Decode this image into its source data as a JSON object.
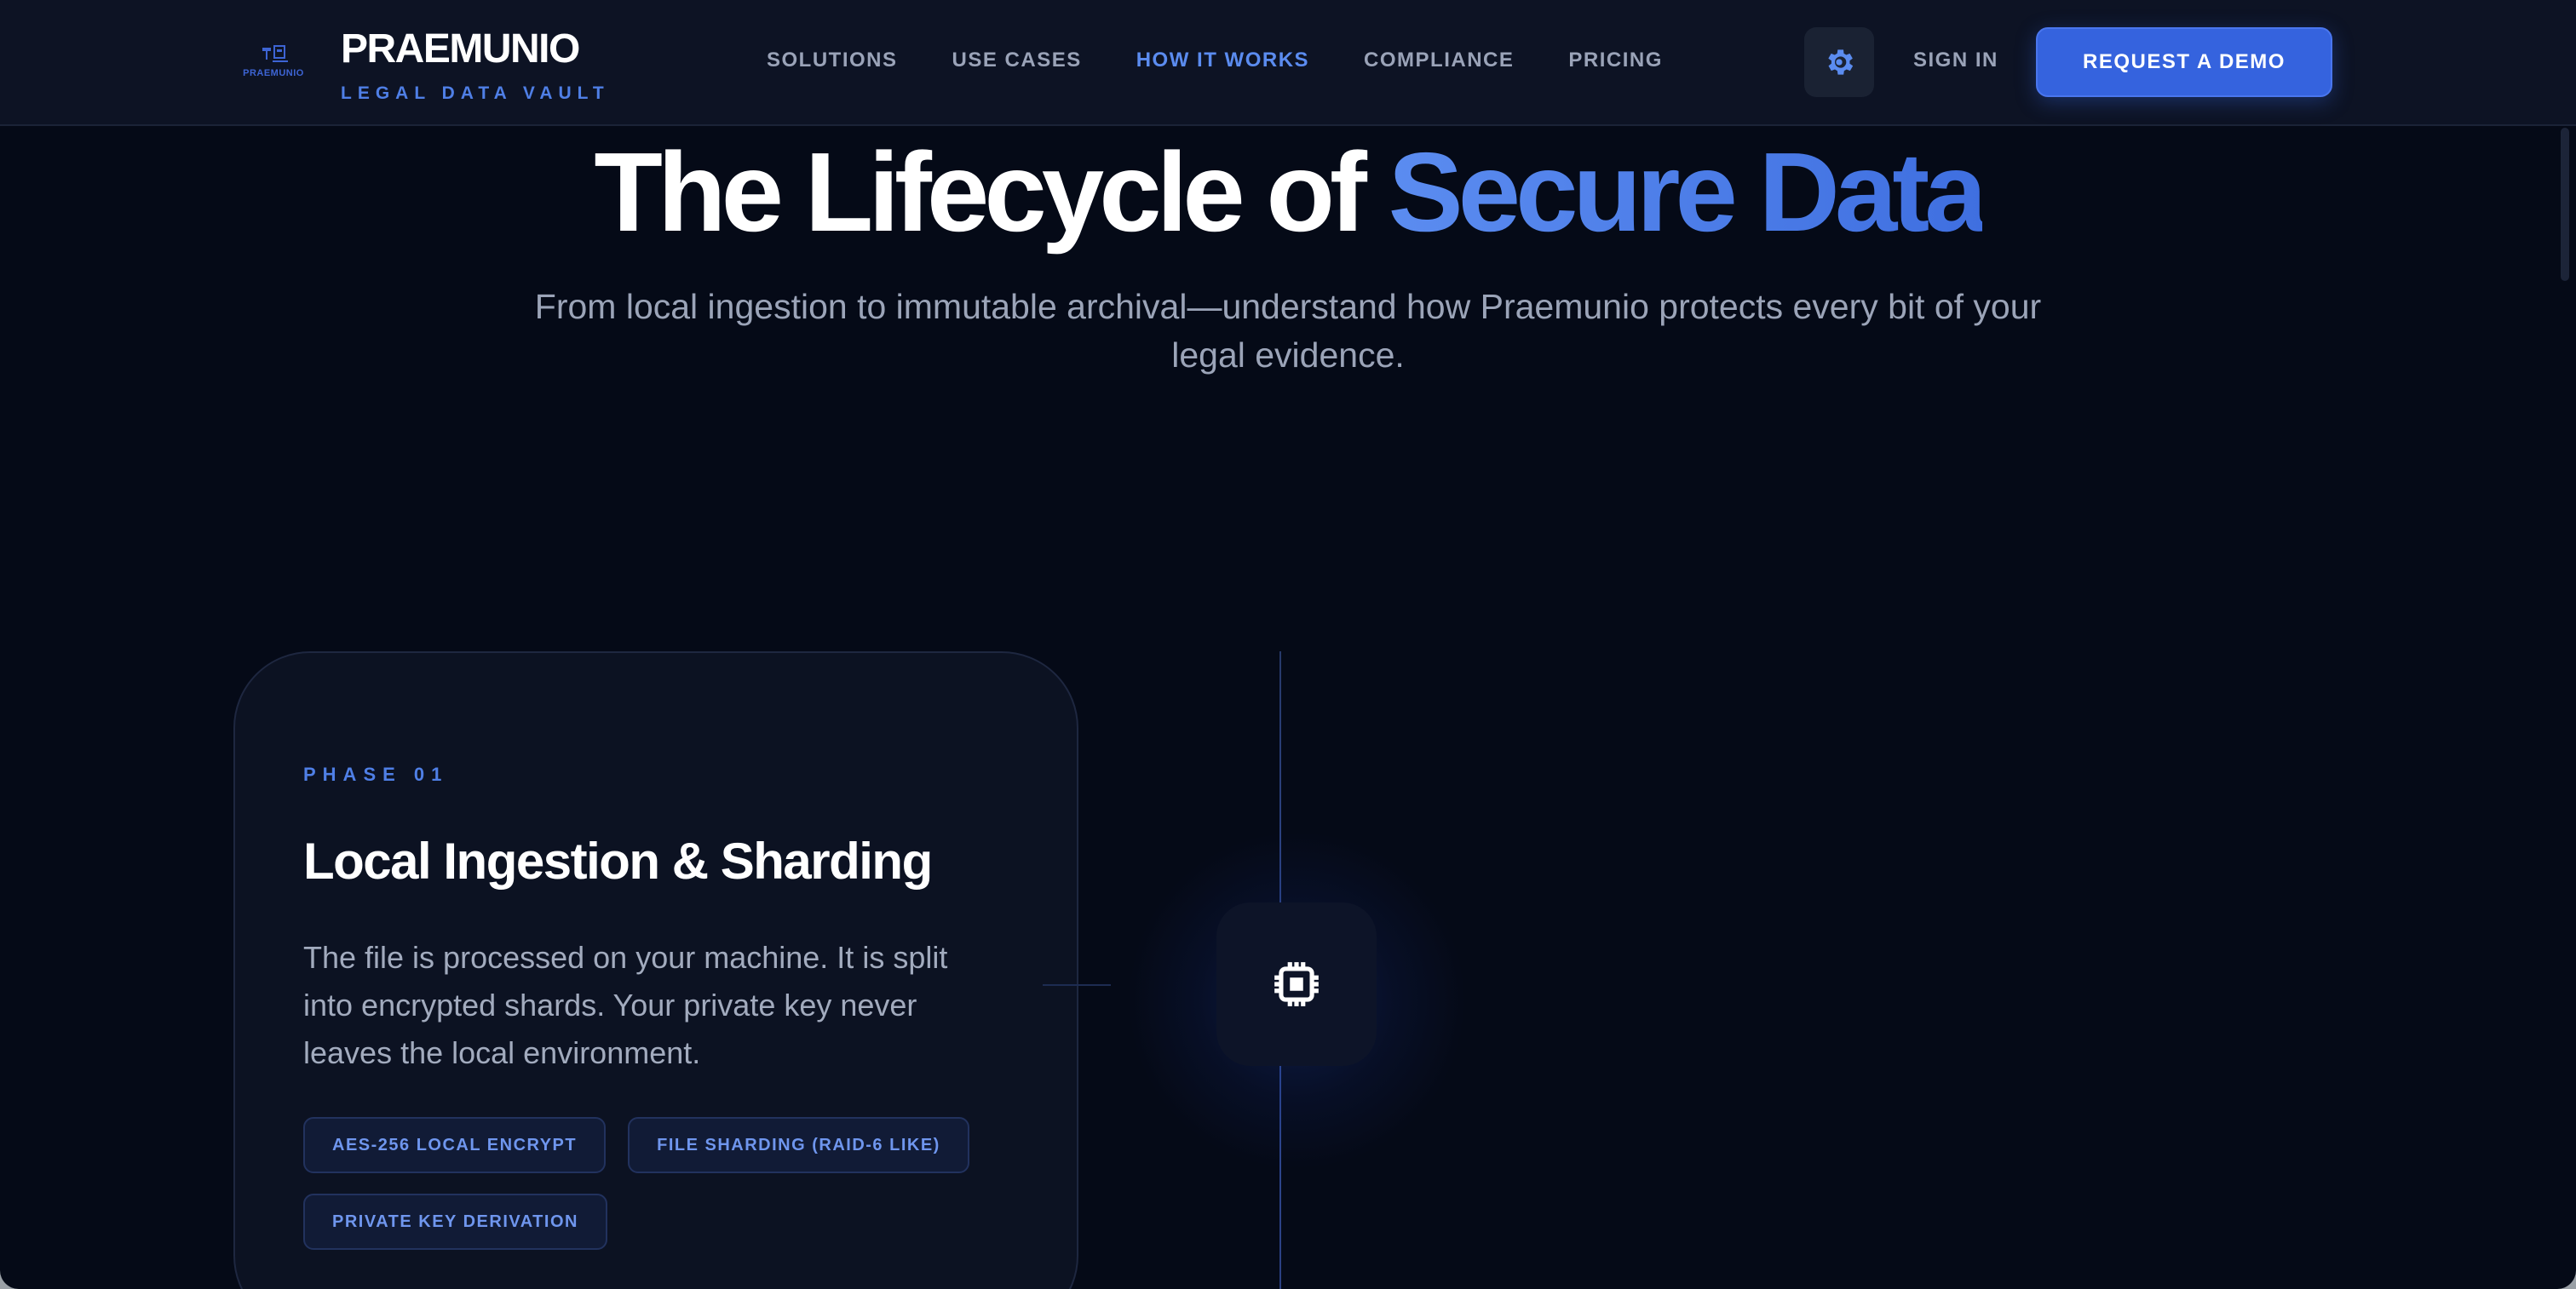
{
  "brand": {
    "mark_text": "PRAEMUNIO",
    "name": "PRAEMUNIO",
    "tagline": "LEGAL DATA VAULT"
  },
  "nav": {
    "links": [
      {
        "label": "SOLUTIONS",
        "active": false
      },
      {
        "label": "USE CASES",
        "active": false
      },
      {
        "label": "HOW IT WORKS",
        "active": true
      },
      {
        "label": "COMPLIANCE",
        "active": false
      },
      {
        "label": "PRICING",
        "active": false
      }
    ],
    "settings_icon": "gear-icon",
    "sign_in": "SIGN IN",
    "cta": "REQUEST A DEMO"
  },
  "hero": {
    "title_plain": "The Lifecycle of ",
    "title_accent": "Secure Data",
    "subtitle": "From local ingestion to immutable archival—understand how Praemunio protects every bit of your legal evidence."
  },
  "phase": {
    "label": "PHASE 01",
    "title": "Local Ingestion & Sharding",
    "description": "The file is processed on your machine. It is split into encrypted shards. Your private key never leaves the local environment.",
    "tags": [
      "AES-256 LOCAL ENCRYPT",
      "FILE SHARDING (RAID-6 LIKE)",
      "PRIVATE KEY DERIVATION"
    ],
    "node_icon": "chip-icon"
  },
  "colors": {
    "accent": "#5b8cf0",
    "cta": "#3563de",
    "background": "#050a17"
  }
}
